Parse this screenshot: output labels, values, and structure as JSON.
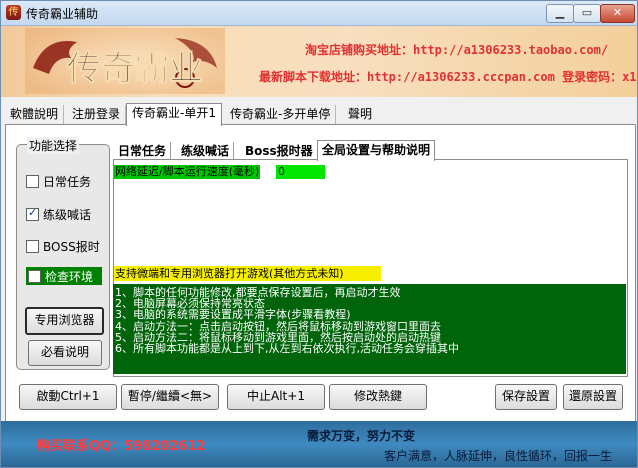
{
  "window": {
    "title": "传奇霸业辅助",
    "controls": [
      "minimize-icon",
      "maximize-icon",
      "close-icon"
    ]
  },
  "banner": {
    "logo_text": "传奇霸业",
    "line1": "淘宝店铺购买地址：http://a1306233.taobao.com/",
    "line2": "最新脚本下载地址：http://a1306233.cccpan.com 登录密码：x1"
  },
  "tabs": [
    {
      "label": "軟體說明"
    },
    {
      "label": "注册登录"
    },
    {
      "label": "传奇霸业-单开1"
    },
    {
      "label": "传奇霸业-多开单停"
    },
    {
      "label": "聲明"
    }
  ],
  "feature_group": {
    "legend": "功能选择",
    "checkboxes": [
      {
        "label": "日常任务",
        "checked": false
      },
      {
        "label": "练级喊话",
        "checked": true
      },
      {
        "label": "BOSS报时",
        "checked": false
      },
      {
        "label": "检查环境",
        "checked": false
      }
    ],
    "browser_button": "专用浏览器",
    "readme_button": "必看说明"
  },
  "inner_tabs": [
    {
      "label": "日常任务"
    },
    {
      "label": "练级喊话"
    },
    {
      "label": "Boss报时器"
    },
    {
      "label": "全局设置与帮助说明"
    }
  ],
  "settings": {
    "delay_label": "网络延迟/脚本运行速度(毫秒)",
    "delay_value": "0",
    "browser_note": "支持微端和专用浏览器打开游戏(其他方式未知)",
    "help_lines": [
      "1、脚本的任何功能修改,都要点保存设置后，再启动才生效",
      "2、电脑屏幕必须保持常亮状态",
      "3、电脑的系统需要设置成平滑字体(步骤看教程)",
      "4、启动方法一：点击启动按钮，然后将鼠标移动到游戏窗口里面去",
      "5、启动方法二：将鼠标移动到游戏里面，然后按启动处的启动热键",
      "6、所有脚本功能都是从上到下,从左到右依次执行,活动任务会穿插其中"
    ]
  },
  "buttons": {
    "start": "啟動Ctrl+1",
    "pause": "暫停/繼續<無>",
    "stop": "中止Alt+1",
    "hotkey": "修改熱鍵",
    "save": "保存設置",
    "restore": "還原設置"
  },
  "footer": {
    "qq": "购买联系QQ：598202612",
    "slogan1": "需求万变，努力不变",
    "slogan2": "客户满意，人脉延伸，良性循环，回报一生"
  },
  "colors": {
    "banner_text": "#e03232",
    "delay_label_bg": "#00c800",
    "note_bg": "#f6f000",
    "help_bg": "#00640a",
    "footer_bg": "#3f8ac0",
    "qq_text": "#ff3b3b"
  }
}
